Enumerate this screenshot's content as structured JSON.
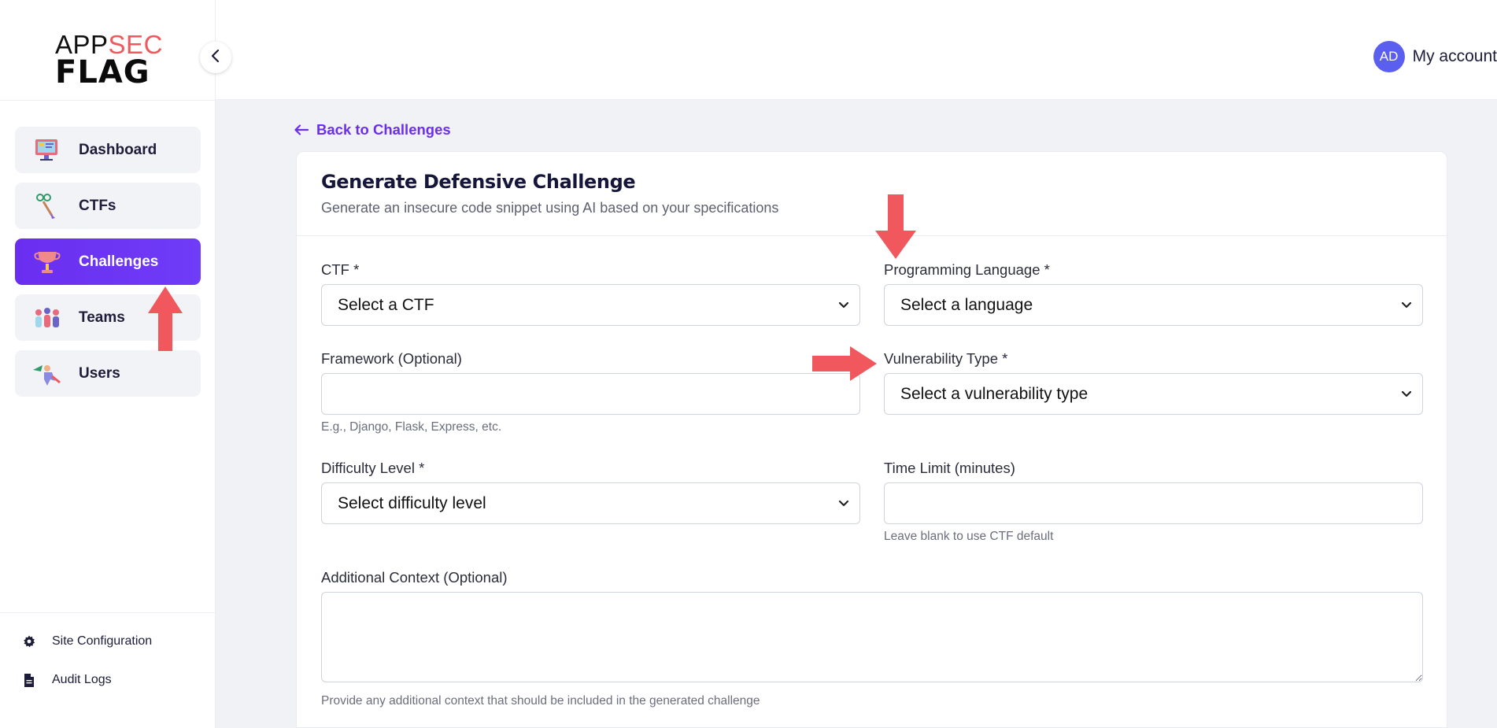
{
  "brand": {
    "logo_top_a": "APP",
    "logo_top_b": "SEC",
    "logo_bottom": "FLAG"
  },
  "sidebar": {
    "items": [
      {
        "label": "Dashboard",
        "icon": "dashboard-icon",
        "active": false
      },
      {
        "label": "CTFs",
        "icon": "ctf-icon",
        "active": false
      },
      {
        "label": "Challenges",
        "icon": "trophy-icon",
        "active": true
      },
      {
        "label": "Teams",
        "icon": "teams-icon",
        "active": false
      },
      {
        "label": "Users",
        "icon": "users-icon",
        "active": false
      }
    ],
    "bottom_links": [
      {
        "label": "Site Configuration",
        "icon": "gear-icon"
      },
      {
        "label": "Audit Logs",
        "icon": "document-icon"
      }
    ]
  },
  "header": {
    "avatar_initials": "AD",
    "account_label": "My account"
  },
  "back_link": "Back to Challenges",
  "form": {
    "title": "Generate Defensive Challenge",
    "subtitle": "Generate an insecure code snippet using AI based on your specifications",
    "ctf": {
      "label": "CTF *",
      "value": "Select a CTF"
    },
    "language": {
      "label": "Programming Language *",
      "value": "Select a language"
    },
    "framework": {
      "label": "Framework (Optional)",
      "value": "",
      "help": "E.g., Django, Flask, Express, etc."
    },
    "vulnerability": {
      "label": "Vulnerability Type *",
      "value": "Select a vulnerability type"
    },
    "difficulty": {
      "label": "Difficulty Level *",
      "value": "Select difficulty level"
    },
    "time_limit": {
      "label": "Time Limit (minutes)",
      "value": "",
      "help": "Leave blank to use CTF default"
    },
    "context": {
      "label": "Additional Context (Optional)",
      "value": "",
      "help": "Provide any additional context that should be included in the generated challenge"
    }
  },
  "colors": {
    "accent": "#6a2ef0",
    "annotation": "#f0585d",
    "avatar": "#5b5ff0"
  }
}
